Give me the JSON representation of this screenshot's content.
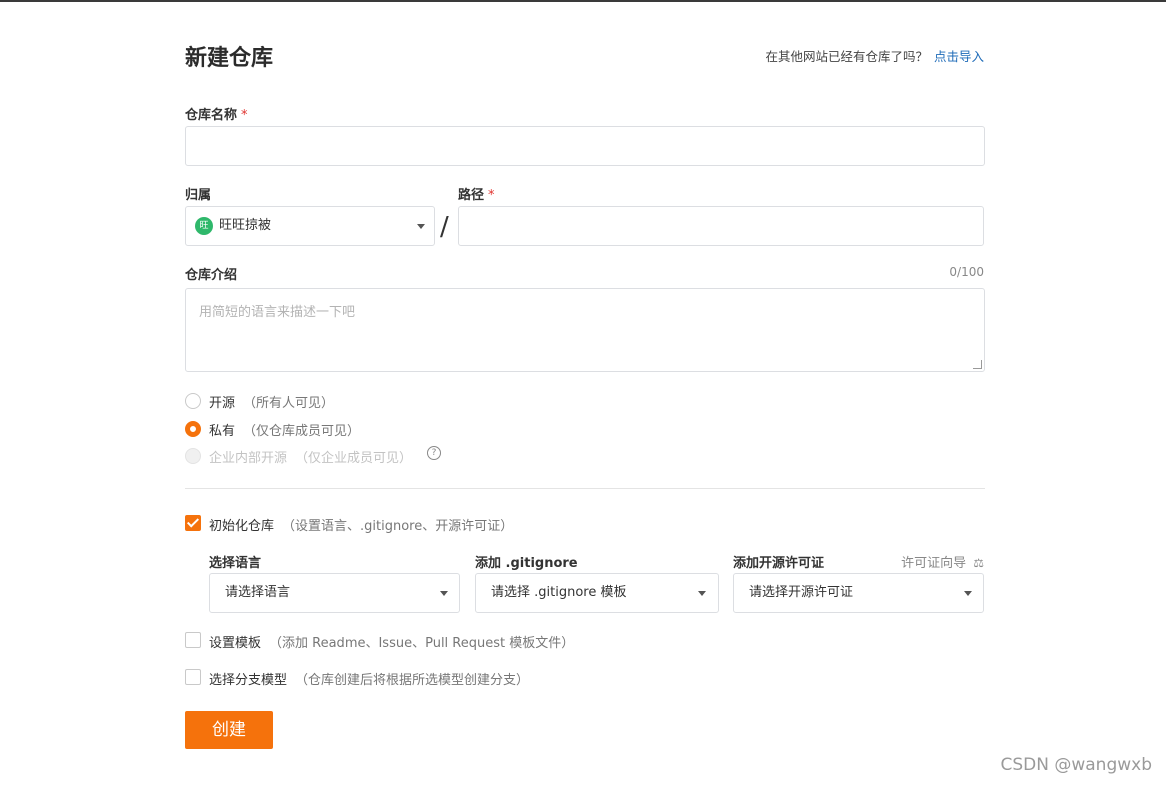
{
  "page": {
    "title": "新建仓库",
    "import_prompt": "在其他网站已经有仓库了吗？",
    "import_link": "点击导入"
  },
  "form": {
    "repo_name": {
      "label": "仓库名称",
      "required_mark": "*",
      "value": ""
    },
    "owner": {
      "label": "归属",
      "avatar_text": "旺",
      "value": "旺旺掠被"
    },
    "path_separator": "/",
    "path": {
      "label": "路径",
      "required_mark": "*",
      "value": ""
    },
    "description": {
      "label": "仓库介绍",
      "counter": "0/100",
      "placeholder": "用简短的语言来描述一下吧"
    },
    "visibility": {
      "options": [
        {
          "label": "开源",
          "hint": "（所有人可见）",
          "state": "unchecked"
        },
        {
          "label": "私有",
          "hint": "（仅仓库成员可见）",
          "state": "checked"
        },
        {
          "label": "企业内部开源",
          "hint": "（仅企业成员可见）",
          "state": "disabled"
        }
      ],
      "help_icon_text": "?"
    },
    "init_repo": {
      "label": "初始化仓库",
      "hint": "（设置语言、.gitignore、开源许可证）",
      "checked": true,
      "language": {
        "label": "选择语言",
        "value": "请选择语言"
      },
      "gitignore": {
        "label": "添加 .gitignore",
        "value": "请选择 .gitignore 模板"
      },
      "license": {
        "label": "添加开源许可证",
        "value": "请选择开源许可证",
        "guide": "许可证向导"
      }
    },
    "template": {
      "label": "设置模板",
      "hint": "（添加 Readme、Issue、Pull Request 模板文件）",
      "checked": false
    },
    "branch_model": {
      "label": "选择分支模型",
      "hint": "（仓库创建后将根据所选模型创建分支）",
      "checked": false
    },
    "submit_label": "创建"
  },
  "watermark": "CSDN @wangwxb",
  "colors": {
    "accent": "#f5720c",
    "link": "#1e6bb8",
    "required": "#e0322e",
    "avatar": "#2fb86b"
  }
}
